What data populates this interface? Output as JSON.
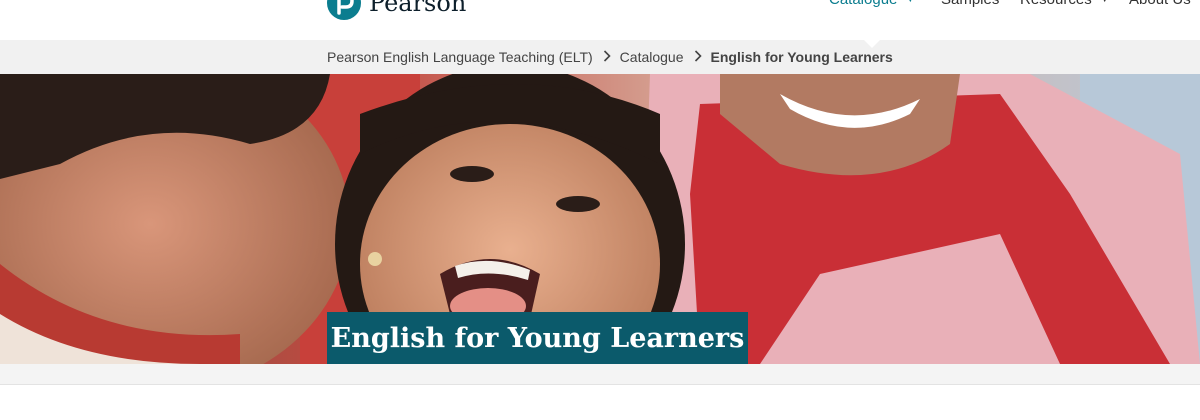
{
  "header": {
    "logo_text": "Pearson",
    "nav": [
      {
        "label": "Catalogue",
        "has_caret": true,
        "active": true
      },
      {
        "label": "Samples",
        "has_caret": false,
        "active": false
      },
      {
        "label": "Resources",
        "has_caret": true,
        "active": false
      },
      {
        "label": "About Us",
        "has_caret": true,
        "active": false
      }
    ],
    "caret_glyph": "▼"
  },
  "breadcrumb": {
    "items": [
      "Pearson English Language Teaching (ELT)",
      "Catalogue"
    ],
    "current": "English for Young Learners",
    "separator_icon": "chevron-right-icon"
  },
  "hero": {
    "title": "English for Young Learners",
    "image_subject": "children-smiling-photo"
  },
  "colors": {
    "brand_teal": "#0b7d8f",
    "title_box": "#0b5a6b",
    "breadcrumb_bg": "#f1f1f1"
  }
}
